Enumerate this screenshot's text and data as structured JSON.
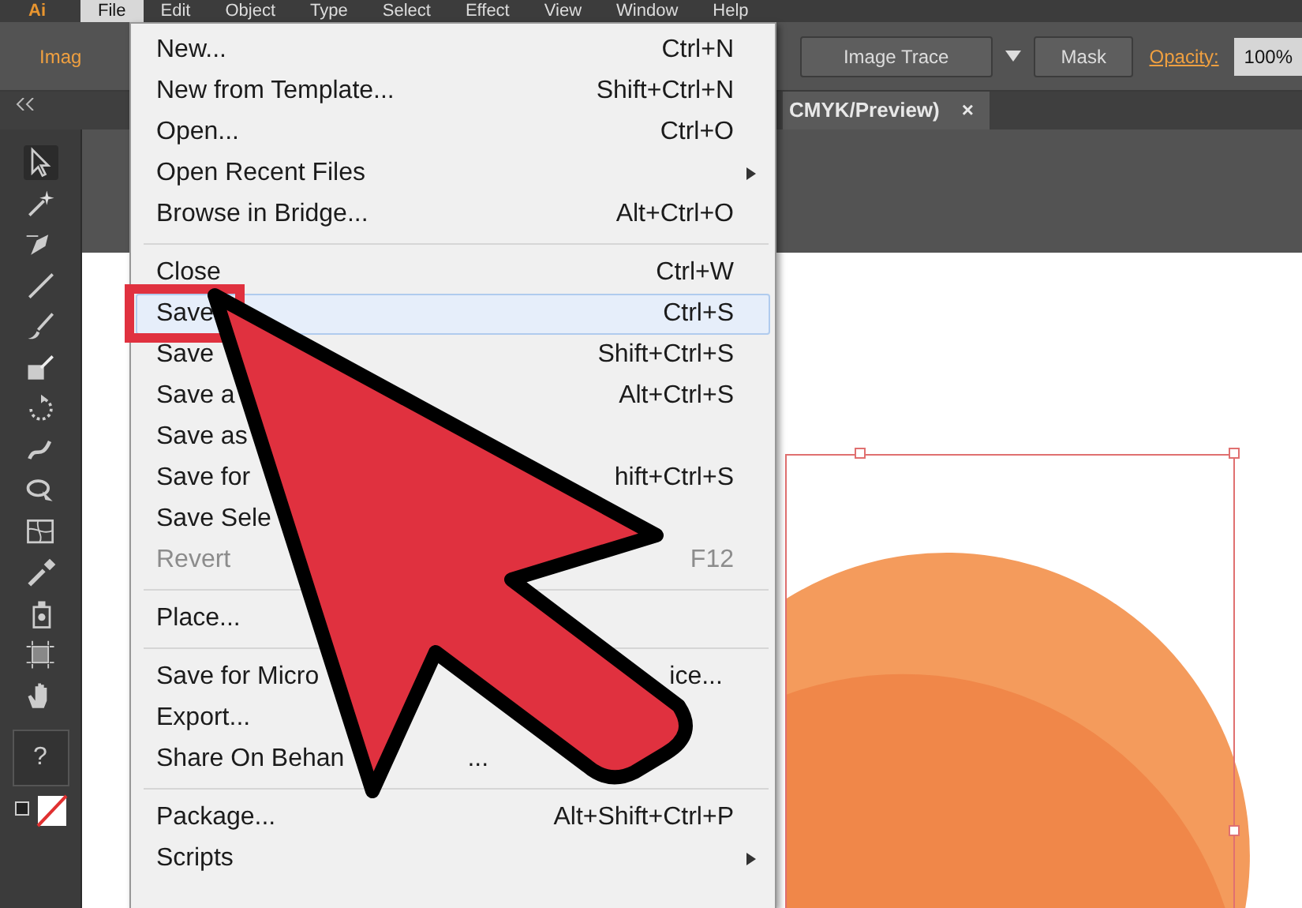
{
  "menubar": {
    "logo": "Ai",
    "items": [
      {
        "label": "File",
        "selected": true
      },
      {
        "label": "Edit",
        "selected": false
      },
      {
        "label": "Object",
        "selected": false
      },
      {
        "label": "Type",
        "selected": false
      },
      {
        "label": "Select",
        "selected": false
      },
      {
        "label": "Effect",
        "selected": false
      },
      {
        "label": "View",
        "selected": false
      },
      {
        "label": "Window",
        "selected": false
      },
      {
        "label": "Help",
        "selected": false
      }
    ]
  },
  "control_bar": {
    "label": "Imag",
    "buttons": [
      "Image Trace",
      "Mask"
    ],
    "opacity_label": "Opacity:",
    "opacity_value": "100%"
  },
  "document_tab": {
    "title": "CMYK/Preview)",
    "close": "×"
  },
  "file_menu": {
    "sections": [
      [
        {
          "label": "New...",
          "shortcut": "Ctrl+N",
          "submenu": false,
          "disabled": false,
          "selected": false
        },
        {
          "label": "New from Template...",
          "shortcut": "Shift+Ctrl+N",
          "submenu": false,
          "disabled": false,
          "selected": false
        },
        {
          "label": "Open...",
          "shortcut": "Ctrl+O",
          "submenu": false,
          "disabled": false,
          "selected": false
        },
        {
          "label": "Open Recent Files",
          "submenu": true,
          "disabled": false,
          "selected": false
        },
        {
          "label": "Browse in Bridge...",
          "shortcut": "Alt+Ctrl+O",
          "submenu": false,
          "disabled": false,
          "selected": false
        }
      ],
      [
        {
          "label": "Close",
          "shortcut": "Ctrl+W",
          "submenu": false,
          "disabled": false,
          "selected": false
        },
        {
          "label": "Save",
          "shortcut": "Ctrl+S",
          "submenu": false,
          "disabled": false,
          "selected": true
        },
        {
          "label": "Save",
          "shortcut": "Shift+Ctrl+S",
          "submenu": false,
          "disabled": false,
          "selected": false
        },
        {
          "label": "Save a",
          "shortcut": "Alt+Ctrl+S",
          "submenu": false,
          "disabled": false,
          "selected": false
        },
        {
          "label": "Save as",
          "submenu": false,
          "disabled": false,
          "selected": false
        },
        {
          "label": "Save for",
          "shortcut": "hift+Ctrl+S",
          "submenu": false,
          "disabled": false,
          "selected": false
        },
        {
          "label": "Save Sele",
          "submenu": false,
          "disabled": false,
          "selected": false
        },
        {
          "label": "Revert",
          "shortcut": "F12",
          "submenu": false,
          "disabled": true,
          "selected": false
        }
      ],
      [
        {
          "label": "Place...",
          "submenu": false,
          "disabled": false,
          "selected": false
        }
      ],
      [
        {
          "label": "Save for Micro",
          "label_tail": "ice...",
          "submenu": false,
          "disabled": false,
          "selected": false
        },
        {
          "label": "Export...",
          "submenu": false,
          "disabled": false,
          "selected": false
        },
        {
          "label": "Share On Behan",
          "label_tail": "...",
          "submenu": false,
          "disabled": false,
          "selected": false
        }
      ],
      [
        {
          "label": "Package...",
          "shortcut": "Alt+Shift+Ctrl+P",
          "submenu": false,
          "disabled": false,
          "selected": false
        },
        {
          "label": "Scripts",
          "submenu": true,
          "disabled": false,
          "selected": false
        }
      ]
    ]
  },
  "toolbar": {
    "help": "?"
  }
}
